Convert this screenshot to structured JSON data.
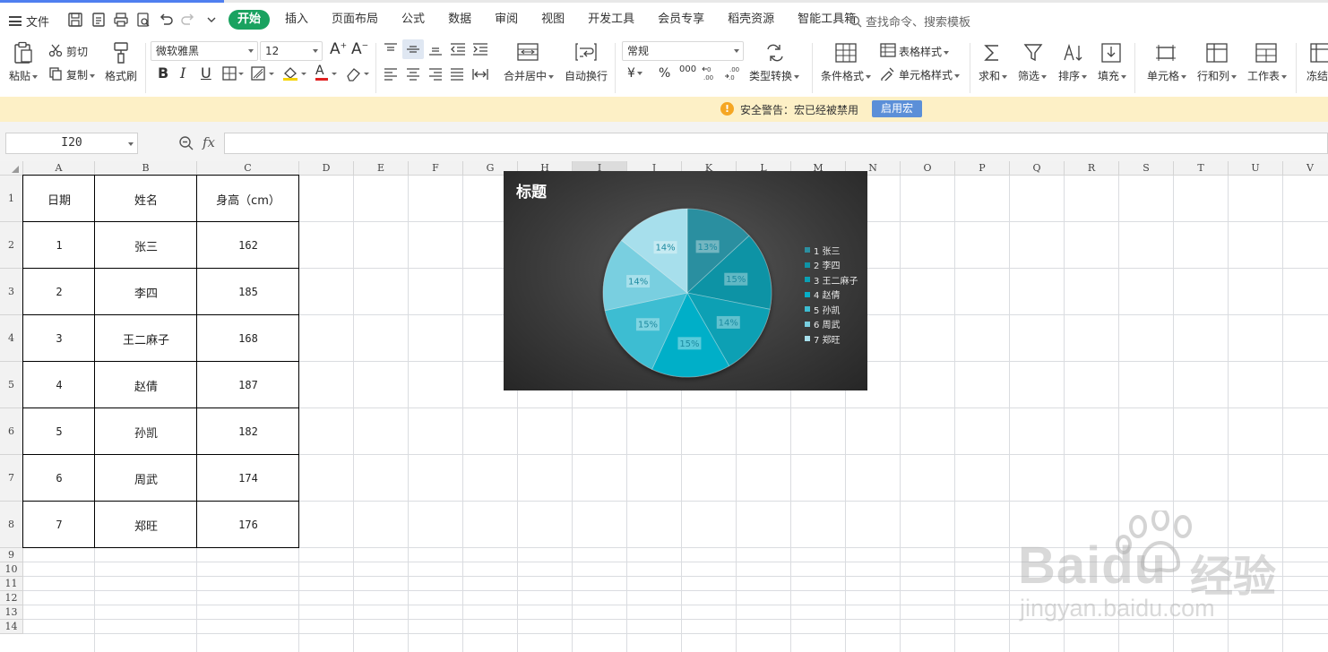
{
  "menubar": {
    "file_label": "文件",
    "tabs": [
      {
        "label": "开始",
        "active": true
      },
      {
        "label": "插入"
      },
      {
        "label": "页面布局"
      },
      {
        "label": "公式"
      },
      {
        "label": "数据"
      },
      {
        "label": "审阅"
      },
      {
        "label": "视图"
      },
      {
        "label": "开发工具"
      },
      {
        "label": "会员专享"
      },
      {
        "label": "稻壳资源"
      },
      {
        "label": "智能工具箱"
      }
    ],
    "search_placeholder": "查找命令、搜索模板"
  },
  "ribbon": {
    "paste": "粘贴",
    "cut": "剪切",
    "copy": "复制",
    "format_painter": "格式刷",
    "font_name": "微软雅黑",
    "font_size": "12",
    "merge_center": "合并居中",
    "wrap_text": "自动换行",
    "number_format": "常规",
    "type_convert": "类型转换",
    "conditional_format": "条件格式",
    "table_style": "表格样式",
    "cell_style": "单元格样式",
    "sum": "求和",
    "filter": "筛选",
    "sort": "排序",
    "fill": "填充",
    "cell": "单元格",
    "row_col": "行和列",
    "worksheet": "工作表",
    "freeze": "冻结",
    "bold": "B",
    "italic": "I",
    "underline": "U",
    "currency": "¥",
    "percent": "%",
    "thousands": "000",
    "font_increase": "A",
    "font_decrease": "A",
    "font_color_letter": "A"
  },
  "warning": {
    "icon": "!",
    "text": "安全警告：宏已经被禁用",
    "button": "启用宏"
  },
  "formula_bar": {
    "name_box": "I20",
    "fx_label": "fx",
    "formula": ""
  },
  "columns": [
    "A",
    "B",
    "C",
    "D",
    "E",
    "F",
    "G",
    "H",
    "I",
    "J",
    "K",
    "L",
    "M",
    "N",
    "O",
    "P",
    "Q",
    "R",
    "S",
    "T",
    "U",
    "V"
  ],
  "selected_column": "I",
  "rows": [
    "1",
    "2",
    "3",
    "4",
    "5",
    "6",
    "7",
    "8",
    "9",
    "10",
    "11",
    "12",
    "13",
    "14"
  ],
  "table": {
    "headers": [
      "日期",
      "姓名",
      "身高（cm）"
    ],
    "rows": [
      [
        "1",
        "张三",
        "162"
      ],
      [
        "2",
        "李四",
        "185"
      ],
      [
        "3",
        "王二麻子",
        "168"
      ],
      [
        "4",
        "赵倩",
        "187"
      ],
      [
        "5",
        "孙凯",
        "182"
      ],
      [
        "6",
        "周武",
        "174"
      ],
      [
        "7",
        "郑旺",
        "176"
      ]
    ]
  },
  "chart_data": {
    "type": "pie",
    "title": "标题",
    "categories": [
      "1 张三",
      "2 李四",
      "3 王二麻子",
      "4 赵倩",
      "5 孙凯",
      "6 周武",
      "7 郑旺"
    ],
    "values": [
      162,
      185,
      168,
      187,
      182,
      174,
      176
    ],
    "data_labels": [
      "13%",
      "15%",
      "14%",
      "15%",
      "15%",
      "14%",
      "14%"
    ],
    "legend_position": "right",
    "colors": [
      "#2b8fa0",
      "#0f93a5",
      "#0aa0b4",
      "#06afc8",
      "#3dbdd2",
      "#79cfe0",
      "#a7dfec"
    ],
    "background": "#3c3c3c"
  },
  "watermark": {
    "brand": "Baidu",
    "brand_cn": "经验",
    "url": "jingyan.baidu.com"
  }
}
